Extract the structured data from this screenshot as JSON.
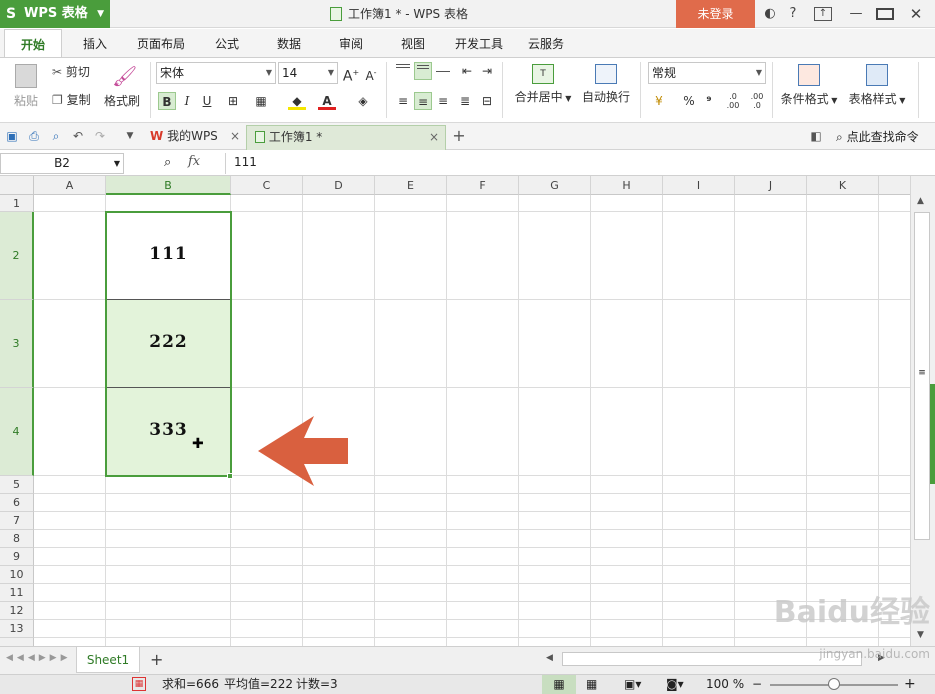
{
  "app": {
    "name": "WPS 表格",
    "title": "工作簿1 * - WPS 表格",
    "login_label": "未登录"
  },
  "ribbon_tabs": [
    "开始",
    "插入",
    "页面布局",
    "公式",
    "数据",
    "审阅",
    "视图",
    "开发工具",
    "云服务"
  ],
  "ribbon": {
    "paste": "粘贴",
    "cut": "剪切",
    "copy": "复制",
    "format_painter": "格式刷",
    "font_name": "宋体",
    "font_size": "14",
    "bold": "B",
    "italic": "I",
    "underline": "U",
    "merge_center": "合并居中",
    "wrap_text": "自动换行",
    "number_format": "常规",
    "percent": "%",
    "comma": "⁹",
    "conditional_format": "条件格式",
    "table_style": "表格样式"
  },
  "doc_tabs": [
    {
      "label": "我的WPS",
      "active": false
    },
    {
      "label": "工作簿1 *",
      "active": true
    }
  ],
  "search_command": "点此查找命令",
  "formula_bar": {
    "cell_ref": "B2",
    "fx": "fx",
    "value": "111"
  },
  "columns": [
    "A",
    "B",
    "C",
    "D",
    "E",
    "F",
    "G",
    "H",
    "I",
    "J",
    "K"
  ],
  "rows": [
    "1",
    "2",
    "3",
    "4",
    "5",
    "6",
    "7",
    "8",
    "9",
    "10",
    "11",
    "12",
    "13"
  ],
  "cells": {
    "B2": "111",
    "B3": "222",
    "B4": "333"
  },
  "sheet_tab": "Sheet1",
  "status": {
    "sum": "求和=666",
    "average": "平均值=222",
    "count": "计数=3",
    "zoom": "100 %"
  },
  "watermark": {
    "text": "Baidu经验",
    "url": "jingyan.baidu.com"
  },
  "colors": {
    "accent": "#4a9d3c",
    "login": "#e06b4b",
    "arrow": "#d9603f",
    "selection": "#e3f3da"
  }
}
